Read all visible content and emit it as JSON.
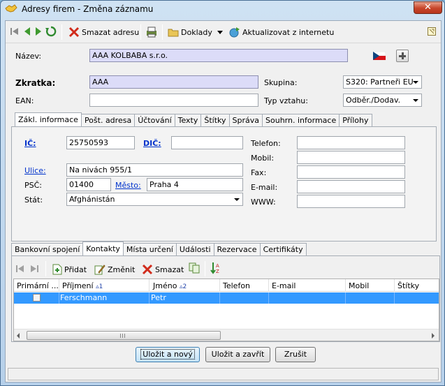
{
  "window": {
    "title": "Adresy firem - Změna záznamu",
    "close": "✕"
  },
  "toolbar": {
    "delete_label": "Smazat adresu",
    "documents_label": "Doklady",
    "update_label": "Aktualizovat z internetu"
  },
  "form": {
    "nazev_label": "Název:",
    "nazev_value": "AAA KOLBABA s.r.o.",
    "zkratka_label": "Zkratka:",
    "zkratka_value": "AAA",
    "skupina_label": "Skupina:",
    "skupina_value": "S320: Partneři EU",
    "ean_label": "EAN:",
    "ean_value": "",
    "typ_label": "Typ vztahu:",
    "typ_value": "Odběr./Dodav."
  },
  "top_tabs": [
    "Zákl. informace",
    "Pošt. adresa",
    "Účtování",
    "Texty",
    "Štítky",
    "Správa",
    "Souhrn. informace",
    "Přílohy"
  ],
  "basic": {
    "ic_label": "IČ:",
    "ic_value": "25750593",
    "dic_label": "DIČ:",
    "dic_value": "",
    "ulice_label": "Ulice:",
    "ulice_value": "Na nivách 955/1",
    "psc_label": "PSČ:",
    "psc_value": "01400",
    "mesto_label": "Město:",
    "mesto_value": "Praha 4",
    "stat_label": "Stát:",
    "stat_value": "Afghánistán",
    "telefon_label": "Telefon:",
    "mobil_label": "Mobil:",
    "fax_label": "Fax:",
    "email_label": "E-mail:",
    "www_label": "WWW:"
  },
  "bottom_tabs": [
    "Bankovní spojení",
    "Kontakty",
    "Místa určení",
    "Události",
    "Rezervace",
    "Certifikáty"
  ],
  "contacts_toolbar": {
    "add": "Přidat",
    "edit": "Změnit",
    "delete": "Smazat"
  },
  "grid": {
    "columns": [
      "Primární ...",
      "Příjmení",
      "Jméno",
      "Telefon",
      "E-mail",
      "Mobil",
      "Štítky"
    ],
    "sort_prijmeni": "1",
    "sort_jmeno": "2",
    "rows": [
      {
        "primarni": false,
        "prijmeni": "Ferschmann",
        "jmeno": "Petr",
        "telefon": "",
        "email": "",
        "mobil": "",
        "stitky": ""
      }
    ]
  },
  "buttons": {
    "save_new": "Uložit a nový",
    "save_close": "Uložit a zavřít",
    "cancel": "Zrušit"
  },
  "colors": {
    "selection": "#3399ff",
    "lavender_field": "#dcdcf8",
    "link": "#0033cc"
  }
}
